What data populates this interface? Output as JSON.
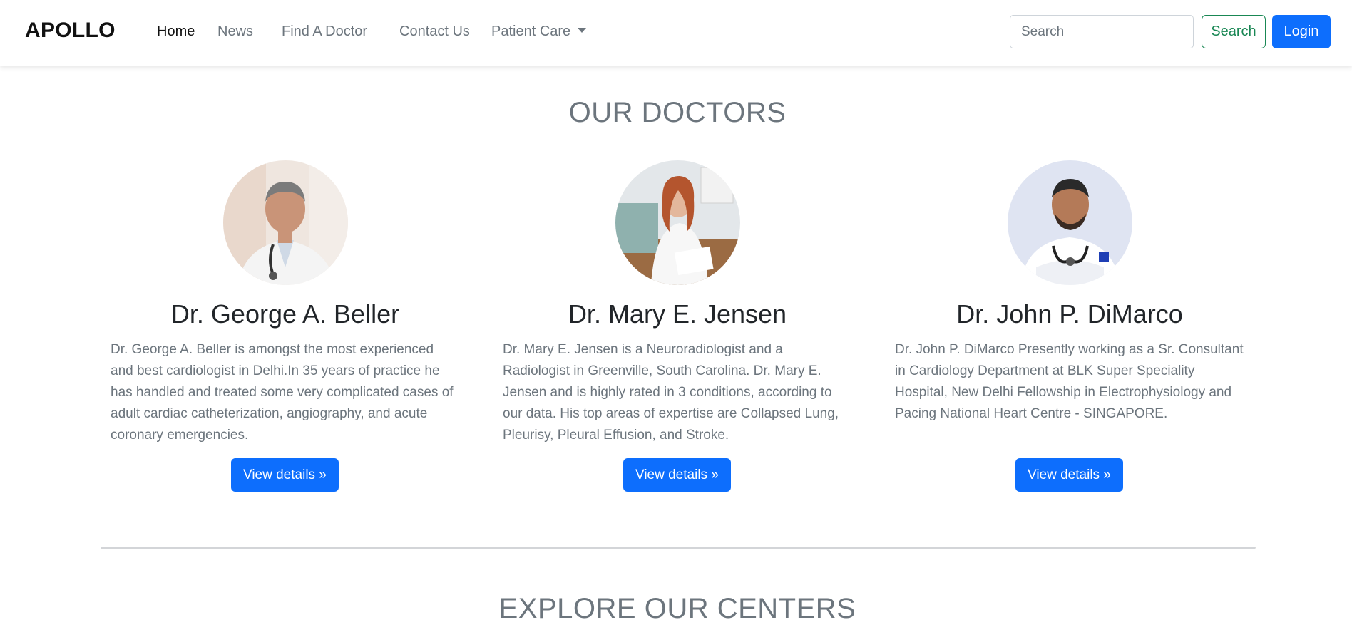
{
  "navbar": {
    "brand": "APOLLO",
    "links": [
      "Home",
      "News",
      "Find A Doctor",
      "Contact Us"
    ],
    "dropdown_label": "Patient Care",
    "search_placeholder": "Search",
    "search_button": "Search",
    "login_button": "Login"
  },
  "doctors_section": {
    "title": "OUR DOCTORS",
    "doctors": [
      {
        "name": "Dr. George A. Beller",
        "description": "Dr. George A. Beller is amongst the most experienced and best cardiologist in Delhi.In 35 years of practice he has handled and treated some very complicated cases of adult cardiac catheterization, angiography, and acute coronary emergencies.",
        "button": "View details »"
      },
      {
        "name": "Dr. Mary E. Jensen",
        "description": "Dr. Mary E. Jensen is a Neuroradiologist and a Radiologist in Greenville, South Carolina. Dr. Mary E. Jensen and is highly rated in 3 conditions, according to our data. His top areas of expertise are Collapsed Lung, Pleurisy, Pleural Effusion, and Stroke.",
        "button": "View details »"
      },
      {
        "name": "Dr. John P. DiMarco",
        "description": "Dr. John P. DiMarco Presently working as a Sr. Consultant in Cardiology Department at BLK Super Speciality Hospital, New Delhi Fellowship in Electrophysiology and Pacing National Heart Centre - SINGAPORE.",
        "button": "View details »"
      }
    ]
  },
  "centers_section": {
    "title": "EXPLORE OUR CENTERS"
  },
  "colors": {
    "primary": "#0d6efd",
    "success": "#198754",
    "muted": "#6c757d"
  }
}
